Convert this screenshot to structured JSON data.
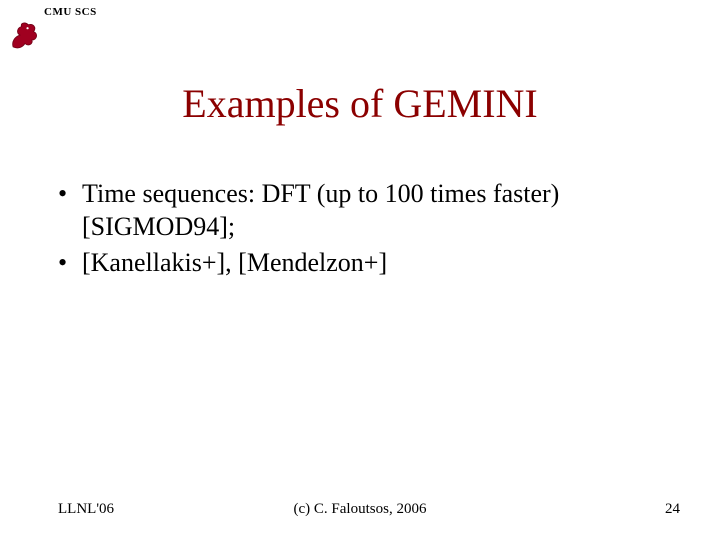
{
  "header": {
    "org_label": "CMU SCS"
  },
  "title": "Examples of GEMINI",
  "bullets": [
    "Time sequences: DFT (up to 100 times faster) [SIGMOD94];",
    "[Kanellakis+], [Mendelzon+]"
  ],
  "footer": {
    "left": "LLNL'06",
    "center": "(c) C. Faloutsos, 2006",
    "right": "24"
  },
  "colors": {
    "title": "#8b0000",
    "logo": "#a00020"
  }
}
